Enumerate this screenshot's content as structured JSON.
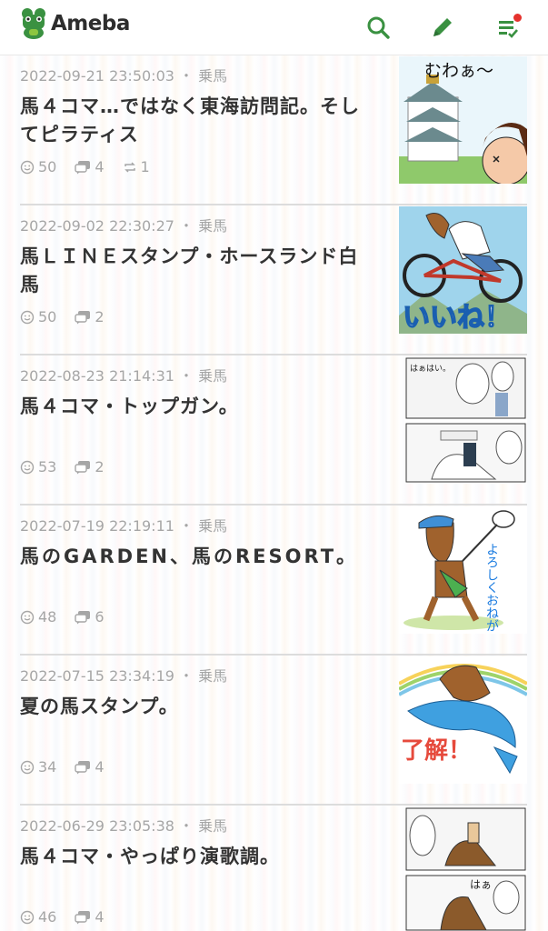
{
  "header": {
    "logo_text": "Ameba",
    "search_icon": "search-icon",
    "write_icon": "pencil-icon",
    "feed_icon": "feed-list-icon",
    "accent": "#3a9141",
    "badge_color": "#e5322d"
  },
  "entries": [
    {
      "date": "2022-09-21 23:50:03",
      "sep": "・",
      "category": "乗馬",
      "title": "馬４コマ…ではなく東海訪問記。そしてピラティス",
      "likes": "50",
      "comments": "4",
      "reblogs": "1"
    },
    {
      "date": "2022-09-02 22:30:27",
      "sep": "・",
      "category": "乗馬",
      "title": "馬ＬＩＮＥスタンプ・ホースランド白馬",
      "likes": "50",
      "comments": "2"
    },
    {
      "date": "2022-08-23 21:14:31",
      "sep": "・",
      "category": "乗馬",
      "title": "馬４コマ・トップガン。",
      "likes": "53",
      "comments": "2"
    },
    {
      "date": "2022-07-19 22:19:11",
      "sep": "・",
      "category": "乗馬",
      "title": "馬のGARDEN、馬のRESORT。",
      "likes": "48",
      "comments": "6"
    },
    {
      "date": "2022-07-15 23:34:19",
      "sep": "・",
      "category": "乗馬",
      "title": "夏の馬スタンプ。",
      "likes": "34",
      "comments": "4"
    },
    {
      "date": "2022-06-29 23:05:38",
      "sep": "・",
      "category": "乗馬",
      "title": "馬４コマ・やっぱり演歌調。",
      "likes": "46",
      "comments": "4"
    }
  ],
  "thumbnails": {
    "t1": "むわぁ〜",
    "t2": "いいね！",
    "t3": "はぁはい。",
    "t4": "よろしくおねがいします",
    "t5": "了解！",
    "t6": "はぁ"
  }
}
